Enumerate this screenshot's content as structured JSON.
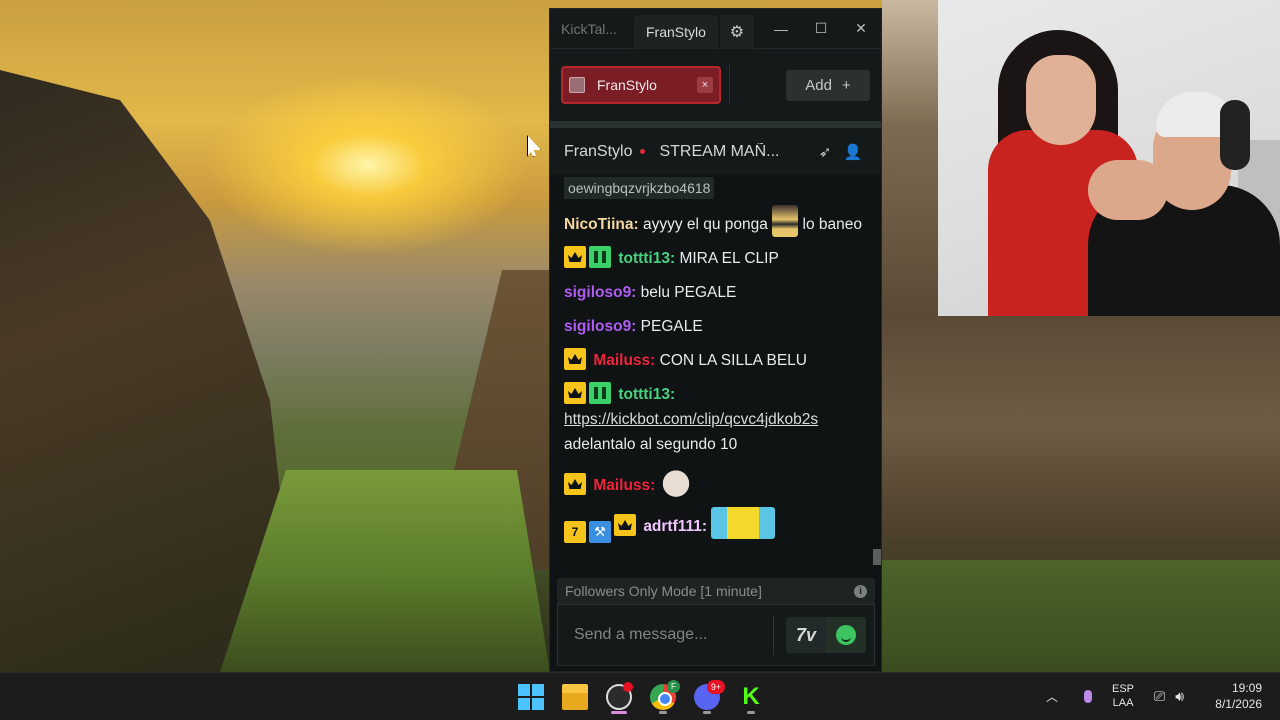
{
  "window": {
    "app_tab": "KickTal...",
    "channel_tab": "FranStylo",
    "settings_icon": "gear-icon",
    "minimize_icon": "minimize-icon",
    "maximize_icon": "maximize-icon",
    "close_icon": "close-icon"
  },
  "channels": {
    "active": {
      "label": "FranStylo",
      "close_glyph": "×"
    },
    "add_label": "Add",
    "add_glyph": "+"
  },
  "stream": {
    "channel_name": "FranStylo",
    "title": "STREAM MAÑ...",
    "live_color": "#e12a3b"
  },
  "chat": {
    "previous_user": "oewingbqzvrjkzbo4618",
    "messages": [
      {
        "user": "NicoTiina:",
        "color": "#f5d7a0",
        "badges": [],
        "parts": [
          "ayyyy el qu ponga",
          "lo baneo"
        ],
        "emote": "bee-emote"
      },
      {
        "user": "tottti13:",
        "color": "#49d17f",
        "badges": [
          "crown",
          "creeper"
        ],
        "text": "MIRA EL CLIP"
      },
      {
        "user": "sigiloso9:",
        "color": "#b05cf5",
        "badges": [],
        "text": "belu PEGALE"
      },
      {
        "user": "sigiloso9:",
        "color": "#b05cf5",
        "badges": [],
        "text": "PEGALE"
      },
      {
        "user": "Mailuss:",
        "color": "#f0233a",
        "badges": [
          "crown"
        ],
        "text": "CON LA SILLA BELU"
      },
      {
        "user": "tottti13:",
        "color": "#49d17f",
        "badges": [
          "crown",
          "creeper"
        ],
        "link": "https://kickbot.com/clip/qcvc4jdkob2s",
        "text": "adelantalo al segundo 10"
      },
      {
        "user": "Mailuss:",
        "color": "#f0233a",
        "badges": [
          "crown"
        ],
        "emote": "cat-emote"
      },
      {
        "user": "adrtf111:",
        "color": "#f1c7ff",
        "badges": [
          "k",
          "mod",
          "crown"
        ],
        "emote": "minion-emote"
      }
    ]
  },
  "input": {
    "mode_notice": "Followers Only Mode [1 minute]",
    "placeholder": "Send a message...",
    "emote_button": "7tv-icon",
    "emoji_button": "smile-icon"
  },
  "taskbar": {
    "apps": [
      "windows-start-icon",
      "file-explorer-icon",
      "obs-icon",
      "chrome-icon",
      "discord-icon",
      "kick-icon"
    ],
    "chrome_profile": "F",
    "discord_badge": "9+",
    "language_top": "ESP",
    "language_bottom": "LAA",
    "time": "19:09",
    "date": "8/1/2026",
    "accent": "#4cc2ff"
  }
}
